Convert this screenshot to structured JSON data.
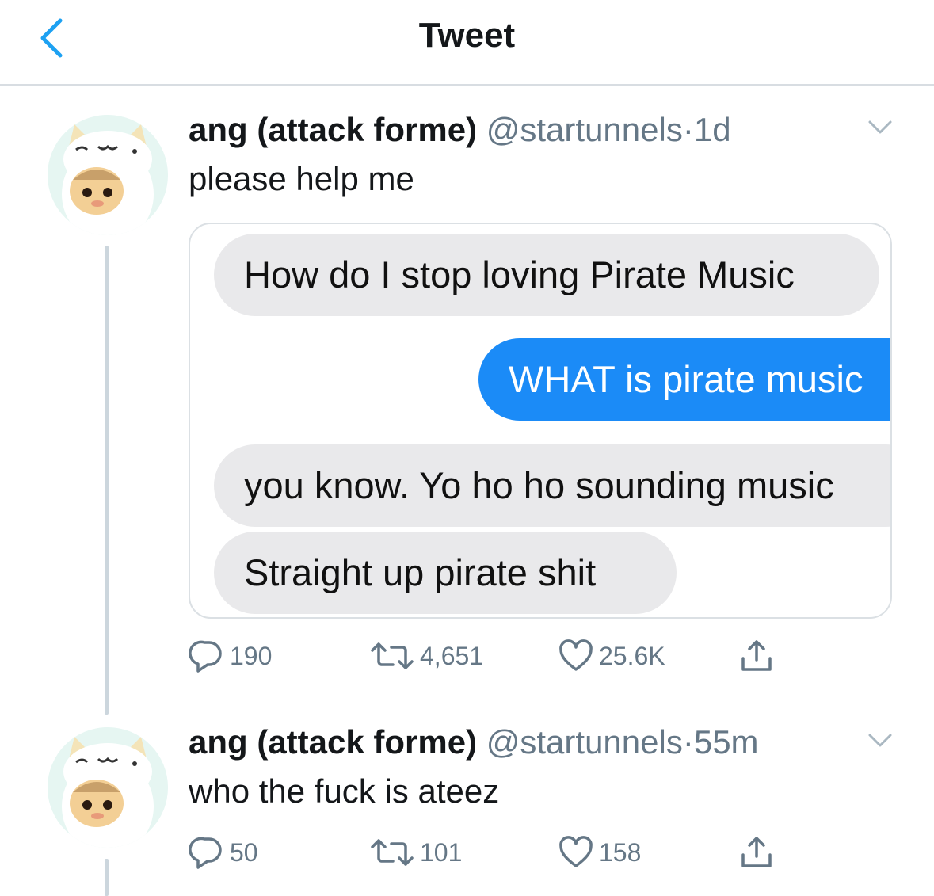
{
  "header": {
    "title": "Tweet",
    "back_icon": "chevron-left-icon"
  },
  "colors": {
    "accent": "#1da1f2",
    "imessage_blue": "#1b8bf7",
    "imessage_gray": "#e9e9eb",
    "secondary_text": "#657786"
  },
  "tweets": [
    {
      "name": "ang (attack forme)",
      "handle": "@startunnels",
      "separator": "·",
      "time": "1d",
      "text": "please help me",
      "image": {
        "messages": [
          {
            "side": "received",
            "text": "How do I stop loving Pirate Music"
          },
          {
            "side": "sent",
            "text": "WHAT is pirate music"
          },
          {
            "side": "received",
            "text": "you know. Yo ho ho sounding music"
          },
          {
            "side": "received",
            "text": "Straight up pirate shit"
          }
        ]
      },
      "stats": {
        "replies": "190",
        "retweets": "4,651",
        "likes": "25.6K"
      }
    },
    {
      "name": "ang (attack forme)",
      "handle": "@startunnels",
      "separator": "·",
      "time": "55m",
      "text": "who the fuck is ateez",
      "stats": {
        "replies": "50",
        "retweets": "101",
        "likes": "158"
      }
    }
  ]
}
